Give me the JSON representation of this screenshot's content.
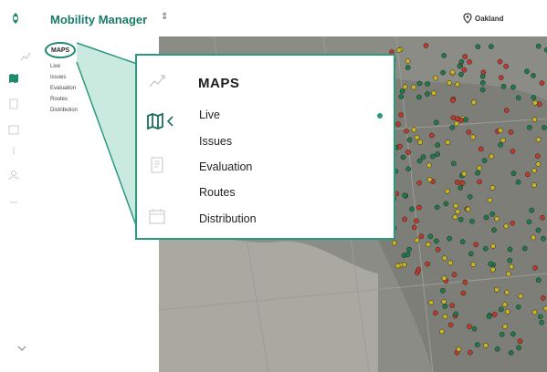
{
  "header": {
    "app_title": "Mobility Manager",
    "city": "Oakland"
  },
  "sidebar": {
    "section": "MAPS",
    "items": [
      {
        "label": "Live"
      },
      {
        "label": "Issues"
      },
      {
        "label": "Evaluation"
      },
      {
        "label": "Routes"
      },
      {
        "label": "Distribution"
      }
    ]
  },
  "callout": {
    "title": "MAPS",
    "items": [
      {
        "label": "Live",
        "active": true
      },
      {
        "label": "Issues"
      },
      {
        "label": "Evaluation"
      },
      {
        "label": "Routes"
      },
      {
        "label": "Distribution"
      }
    ]
  },
  "icons": [
    "logo-icon",
    "updown-icon",
    "location-pin-icon",
    "chart-icon",
    "map-icon",
    "document-icon",
    "calendar-icon",
    "collapse-chevron-icon"
  ],
  "colors": {
    "brand": "#1f8a6e",
    "accent": "#2a9a7d",
    "map_base": "#8a8a84",
    "marker_green": "#1f7a4a",
    "marker_red": "#c0392b",
    "marker_yellow": "#c9b521"
  }
}
